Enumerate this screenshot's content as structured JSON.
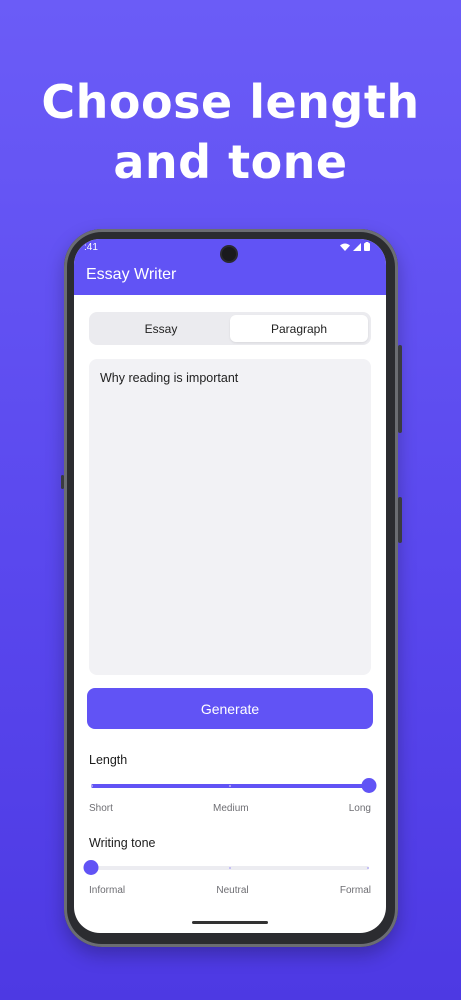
{
  "headline": {
    "line1": "Choose length",
    "line2": "and tone"
  },
  "status_bar": {
    "time": ":41"
  },
  "app": {
    "title": "Essay Writer"
  },
  "tabs": [
    {
      "label": "Essay",
      "selected": false
    },
    {
      "label": "Paragraph",
      "selected": true
    }
  ],
  "prompt": {
    "value": "Why reading is important"
  },
  "generate_button": {
    "label": "Generate"
  },
  "length": {
    "label": "Length",
    "options": [
      "Short",
      "Medium",
      "Long"
    ],
    "value": 1.0
  },
  "tone": {
    "label": "Writing tone",
    "options": [
      "Informal",
      "Neutral",
      "Formal"
    ],
    "value": 0.0
  },
  "colors": {
    "accent": "#6153f5",
    "background": "#5a48ee"
  }
}
